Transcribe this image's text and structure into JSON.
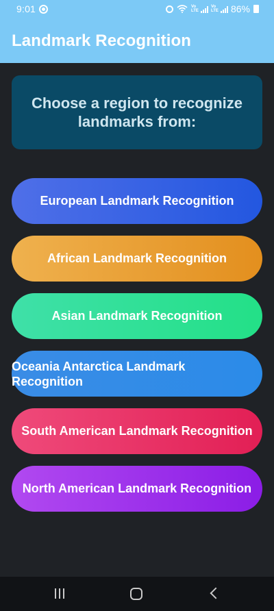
{
  "status_bar": {
    "time": "9:01",
    "battery": "86%",
    "icons": [
      "app-notification-icon",
      "alarm-icon",
      "wifi-icon",
      "volte-signal-icon",
      "volte-signal-icon",
      "battery-icon"
    ]
  },
  "app_bar": {
    "title": "Landmark Recognition"
  },
  "header": {
    "text": "Choose a region to recognize landmarks from:"
  },
  "regions": [
    {
      "label": "European Landmark Recognition",
      "color": "#2357e0"
    },
    {
      "label": "African Landmark Recognition",
      "color": "#e38f1e"
    },
    {
      "label": "Asian Landmark Recognition",
      "color": "#23e087"
    },
    {
      "label": "Oceania Antarctica Landmark Recognition",
      "color": "#2b8be8"
    },
    {
      "label": "South American Landmark Recognition",
      "color": "#e21f55"
    },
    {
      "label": "North American Landmark Recognition",
      "color": "#8b1de6"
    }
  ],
  "colors": {
    "app_bar": "#7cc9f6",
    "background": "#1f2226",
    "header_card": "#0a4a66"
  }
}
